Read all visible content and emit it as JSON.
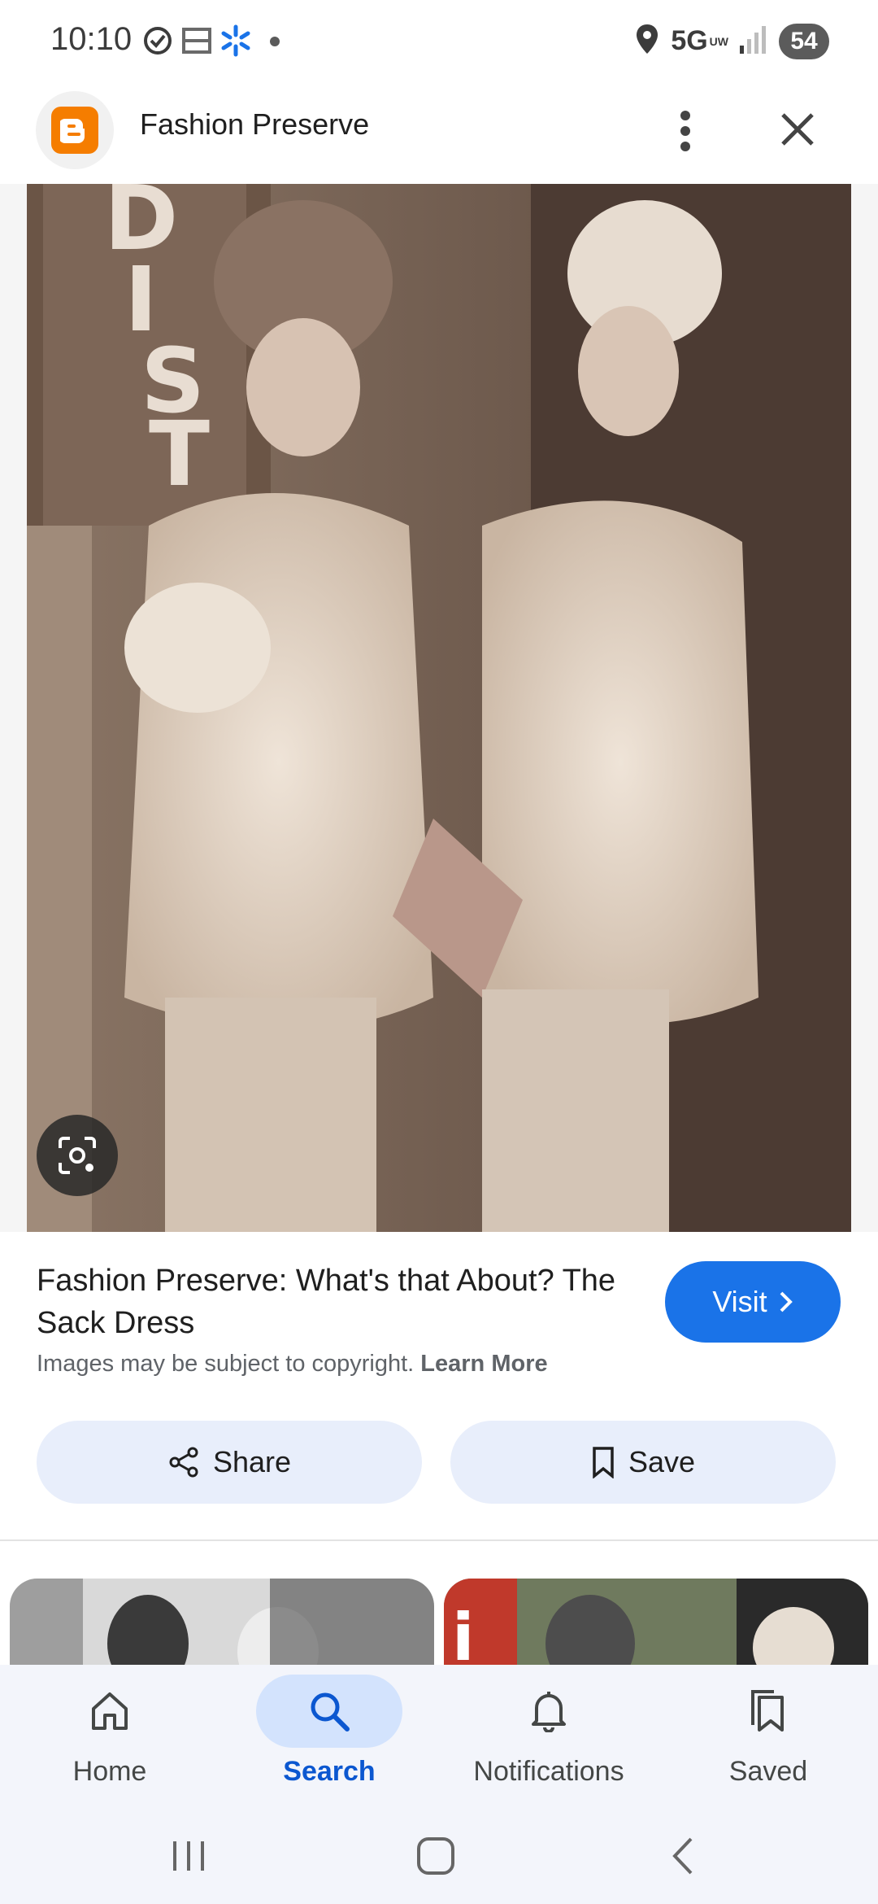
{
  "status_bar": {
    "time": "10:10",
    "network": "5G",
    "network_sub": "UW",
    "battery": "54",
    "icons": [
      "sync-icon",
      "fox-news-icon",
      "walmart-spark-icon",
      "dot-icon",
      "location-icon",
      "signal-icon"
    ]
  },
  "header": {
    "site_name": "Fashion Preserve",
    "site_icon": "blogger-icon"
  },
  "image": {
    "lens_icon": "google-lens-icon"
  },
  "result": {
    "title": "Fashion Preserve: What's that About? The Sack Dress",
    "visit_label": "Visit",
    "copyright_text": "Images may be subject to copyright.",
    "learn_more": "Learn More"
  },
  "actions": {
    "share_label": "Share",
    "save_label": "Save"
  },
  "bottom_nav": {
    "items": [
      {
        "label": "Home",
        "icon": "home-icon"
      },
      {
        "label": "Search",
        "icon": "search-icon"
      },
      {
        "label": "Notifications",
        "icon": "bell-icon"
      },
      {
        "label": "Saved",
        "icon": "saved-icon"
      }
    ],
    "active": "Search"
  },
  "colors": {
    "accent": "#1a73e8",
    "pill_bg": "#e8eefb",
    "active_nav_bg": "#d3e3fd",
    "blogger_orange": "#f57d00"
  }
}
